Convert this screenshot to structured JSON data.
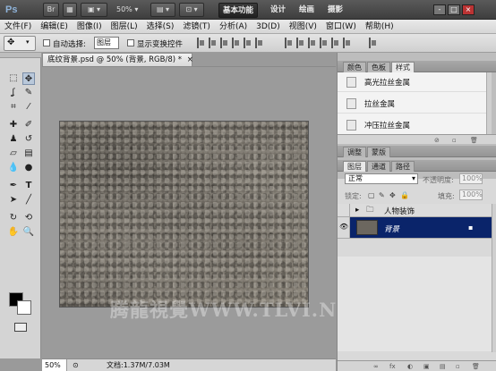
{
  "app": {
    "logo": "Ps",
    "zoom": "50%",
    "workspaces": [
      "基本功能",
      "设计",
      "绘画",
      "摄影"
    ],
    "active_workspace": "基本功能",
    "window_controls": [
      "-",
      "□",
      "×"
    ]
  },
  "menu": [
    "文件(F)",
    "编辑(E)",
    "图像(I)",
    "图层(L)",
    "选择(S)",
    "滤镜(T)",
    "分析(A)",
    "3D(D)",
    "视图(V)",
    "窗口(W)",
    "帮助(H)"
  ],
  "options": {
    "auto_select_label": "自动选择:",
    "auto_select_value": "图层",
    "show_transform_label": "显示变换控件"
  },
  "document": {
    "tab_title": "底纹背景.psd @ 50% (背景, RGB/8) *",
    "tab_close": "×",
    "watermark": "腾龍視覺WWW.TLVI.NET",
    "status_zoom": "50%",
    "status_info": "文档:1.37M/7.03M"
  },
  "styles_panel": {
    "tabs": [
      "颜色",
      "色板",
      "样式"
    ],
    "active_tab": "样式",
    "items": [
      "高光拉丝金属",
      "拉丝金属",
      "冲压拉丝金属"
    ]
  },
  "adjust_panel": {
    "tabs": [
      "调整",
      "蒙版"
    ]
  },
  "layers_panel": {
    "tabs": [
      "图层",
      "通道",
      "路径"
    ],
    "active_tab": "图层",
    "blend_mode": "正常",
    "opacity_label": "不透明度:",
    "opacity_value": "100%",
    "lock_label": "锁定:",
    "fill_label": "填充:",
    "fill_value": "100%",
    "layers": [
      {
        "name": "人物装饰",
        "type": "group",
        "visible": false
      },
      {
        "name": "背景",
        "type": "layer",
        "visible": true,
        "selected": true
      }
    ],
    "footer_icons": [
      "∞",
      "fx",
      "◐",
      "▣",
      "▤",
      "▫",
      "🗑"
    ]
  },
  "colors": {
    "appbar": "#4a4a4a",
    "canvas_bg": "#9b9b9b",
    "selected_layer": "#0a246a",
    "texture": "#6f6a62"
  }
}
